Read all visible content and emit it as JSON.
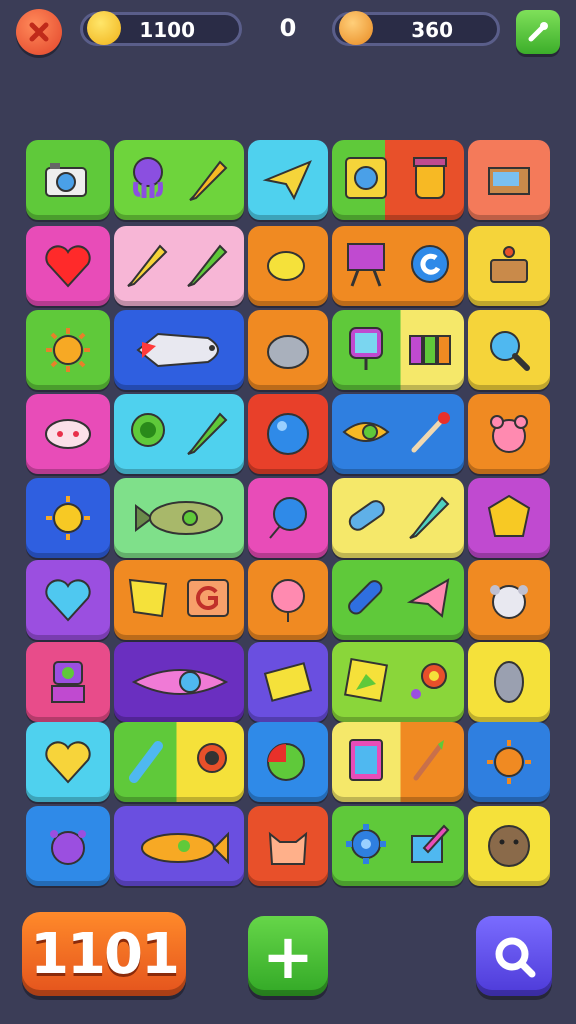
{
  "hud": {
    "close_icon": "x-icon",
    "coins": "1100",
    "moves": "0",
    "score": "360",
    "settings_icon": "wrench-icon"
  },
  "bottom": {
    "counter": "1101",
    "add_label": "+",
    "search_icon": "magnifier-icon"
  },
  "colors": {
    "background": "#3b3d57",
    "green": "#5fc93a",
    "pink": "#e84cb8",
    "blue": "#2f5fe0",
    "orange": "#f08a22",
    "yellow": "#f5d43a",
    "purple": "#9b4fe0",
    "cyan": "#4fd1ee",
    "red": "#e8502a"
  },
  "board": [
    [
      "camera-icon",
      "octopus-icon",
      "pencil-icon",
      "paper-plane-icon",
      "framed-picture-icon",
      "jar-icon",
      "box-icon"
    ],
    [
      "heart-icon",
      "pencil-icon",
      "pencil-icon",
      "lemon-icon",
      "easel-icon",
      "swirl-icon",
      "basket-icon"
    ],
    [
      "sun-icon",
      "fish-icon",
      "egg-icon",
      "mirror-icon",
      "books-icon",
      "magnifier-icon"
    ],
    [
      "face-icon",
      "frog-icon",
      "crayon-icon",
      "ball-icon",
      "eye-icon",
      "match-icon",
      "bear-icon"
    ],
    [
      "sun-face-icon",
      "fish-icon",
      "balloon-icon",
      "crayon-icon",
      "pencil-icon",
      "badge-icon"
    ],
    [
      "heart-icon",
      "paper-icon",
      "letter-g-icon",
      "mask-icon",
      "crayon-icon",
      "paper-plane-icon",
      "cloud-face-icon"
    ],
    [
      "robot-icon",
      "eye-icon",
      "postcard-icon",
      "map-icon",
      "target-icon",
      "shield-icon"
    ],
    [
      "heart-face-icon",
      "brush-icon",
      "magnifier-icon",
      "fruit-icon",
      "picture-icon",
      "brush-icon",
      "sun-face-icon"
    ],
    [
      "monster-icon",
      "fish-icon",
      "cat-icon",
      "gear-icon",
      "pencil-icon",
      "face-icon"
    ]
  ]
}
